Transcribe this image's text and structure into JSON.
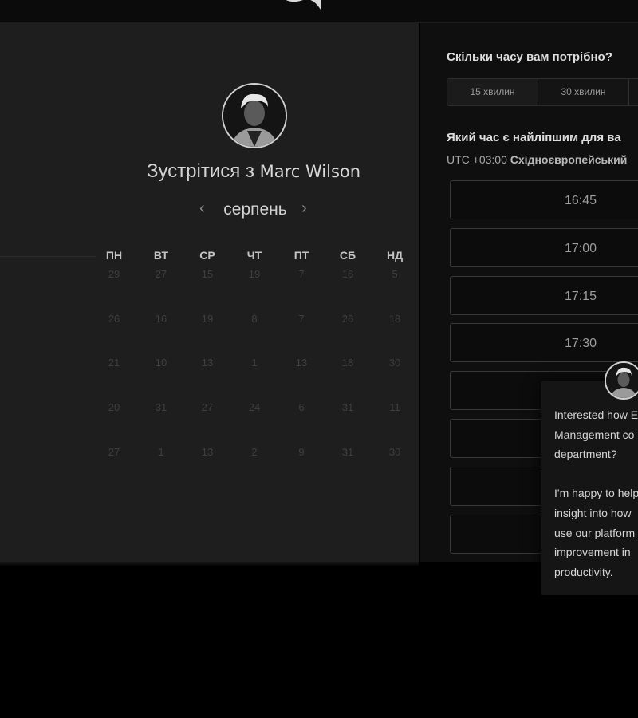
{
  "meeting": {
    "prefix": "Зустрітися з",
    "host_name": "Marc Wilson"
  },
  "calendar": {
    "month": "серпень",
    "prev_arrow": "‹",
    "next_arrow": "›",
    "weekdays": [
      "ПН",
      "ВТ",
      "СР",
      "ЧТ",
      "ПТ",
      "СБ",
      "НД"
    ],
    "weeks": [
      [
        "29",
        "27",
        "15",
        "19",
        "7",
        "16",
        "5"
      ],
      [
        "26",
        "16",
        "19",
        "8",
        "7",
        "26",
        "18"
      ],
      [
        "21",
        "10",
        "13",
        "1",
        "13",
        "18",
        "30"
      ],
      [
        "20",
        "31",
        "27",
        "24",
        "6",
        "31",
        "11"
      ],
      [
        "27",
        "1",
        "13",
        "2",
        "9",
        "31",
        "30"
      ]
    ]
  },
  "booking": {
    "duration_question": "Скільки часу вам потрібно?",
    "durations": [
      "15 хвилин",
      "30 хвилин"
    ],
    "time_question": "Який час є найліпшим для ва",
    "timezone_offset": "UTC +03:00",
    "timezone_name": "Східноєвропейський",
    "slots": [
      "16:45",
      "17:00",
      "17:15",
      "17:30",
      "",
      "",
      ""
    ]
  },
  "chat": {
    "lines": [
      "Interested how E",
      "Management co",
      "department?",
      "",
      "I'm happy to help",
      "insight into how",
      "use our platform",
      "improvement in",
      "productivity."
    ]
  }
}
